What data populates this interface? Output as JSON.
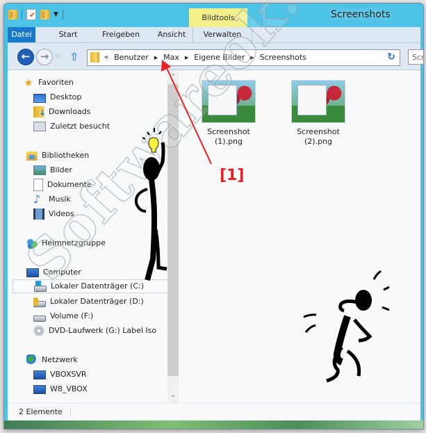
{
  "window": {
    "title": "Screenshots",
    "contextual_tab_group": "Bildtools"
  },
  "quick_access_toolbar": {
    "icons": [
      "folder-icon",
      "properties-icon",
      "new-folder-icon",
      "customize-dropdown-icon"
    ]
  },
  "ribbon": {
    "tabs": [
      {
        "label": "Datei",
        "active": true
      },
      {
        "label": "Start"
      },
      {
        "label": "Freigeben"
      },
      {
        "label": "Ansicht"
      },
      {
        "label": "Verwalten"
      }
    ]
  },
  "address_bar": {
    "back_icon": "←",
    "forward_icon": "→",
    "recent_icon": "▽",
    "up_icon": "🡅",
    "overflow": "«",
    "breadcrumbs": [
      "Benutzer",
      "Max",
      "Eigene Bilder",
      "Screenshots"
    ],
    "crumb_separator": "▶",
    "refresh_icon": "↻",
    "search_placeholder": "Screenshots durchsuchen",
    "search_visible": "Scr"
  },
  "navigation_pane": {
    "favorites": {
      "label": "Favoriten",
      "items": [
        "Desktop",
        "Downloads",
        "Zuletzt besucht"
      ]
    },
    "libraries": {
      "label": "Bibliotheken",
      "items": [
        "Bilder",
        "Dokumente",
        "Musik",
        "Videos"
      ]
    },
    "homegroup": {
      "label": "Heimnetzgruppe"
    },
    "computer": {
      "label": "Computer",
      "items": [
        "Lokaler Datenträger (C:)",
        "Lokaler Datenträger (D:)",
        "Volume (F:)",
        "DVD-Laufwerk (G:) Label Iso"
      ],
      "selected": "Lokaler Datenträger (C:)"
    },
    "network": {
      "label": "Netzwerk",
      "items": [
        "VBOXSVR",
        "W8_VBOX"
      ]
    }
  },
  "scrollbar": {
    "up": "⌃",
    "down": "⌄"
  },
  "files": [
    {
      "name_line1": "Screenshot",
      "name_line2": "(1).png"
    },
    {
      "name_line1": "Screenshot",
      "name_line2": "(2).png"
    }
  ],
  "status_bar": {
    "item_count": "2 Elemente"
  },
  "annotations": {
    "label": "[1]",
    "arrow_color": "#e62222",
    "watermark": "Softwareok.de"
  },
  "colors": {
    "titlebar": "#4ec3e8",
    "file_tab": "#1979ca",
    "context_tab": "#f3f08b",
    "annotation": "#e62222"
  }
}
